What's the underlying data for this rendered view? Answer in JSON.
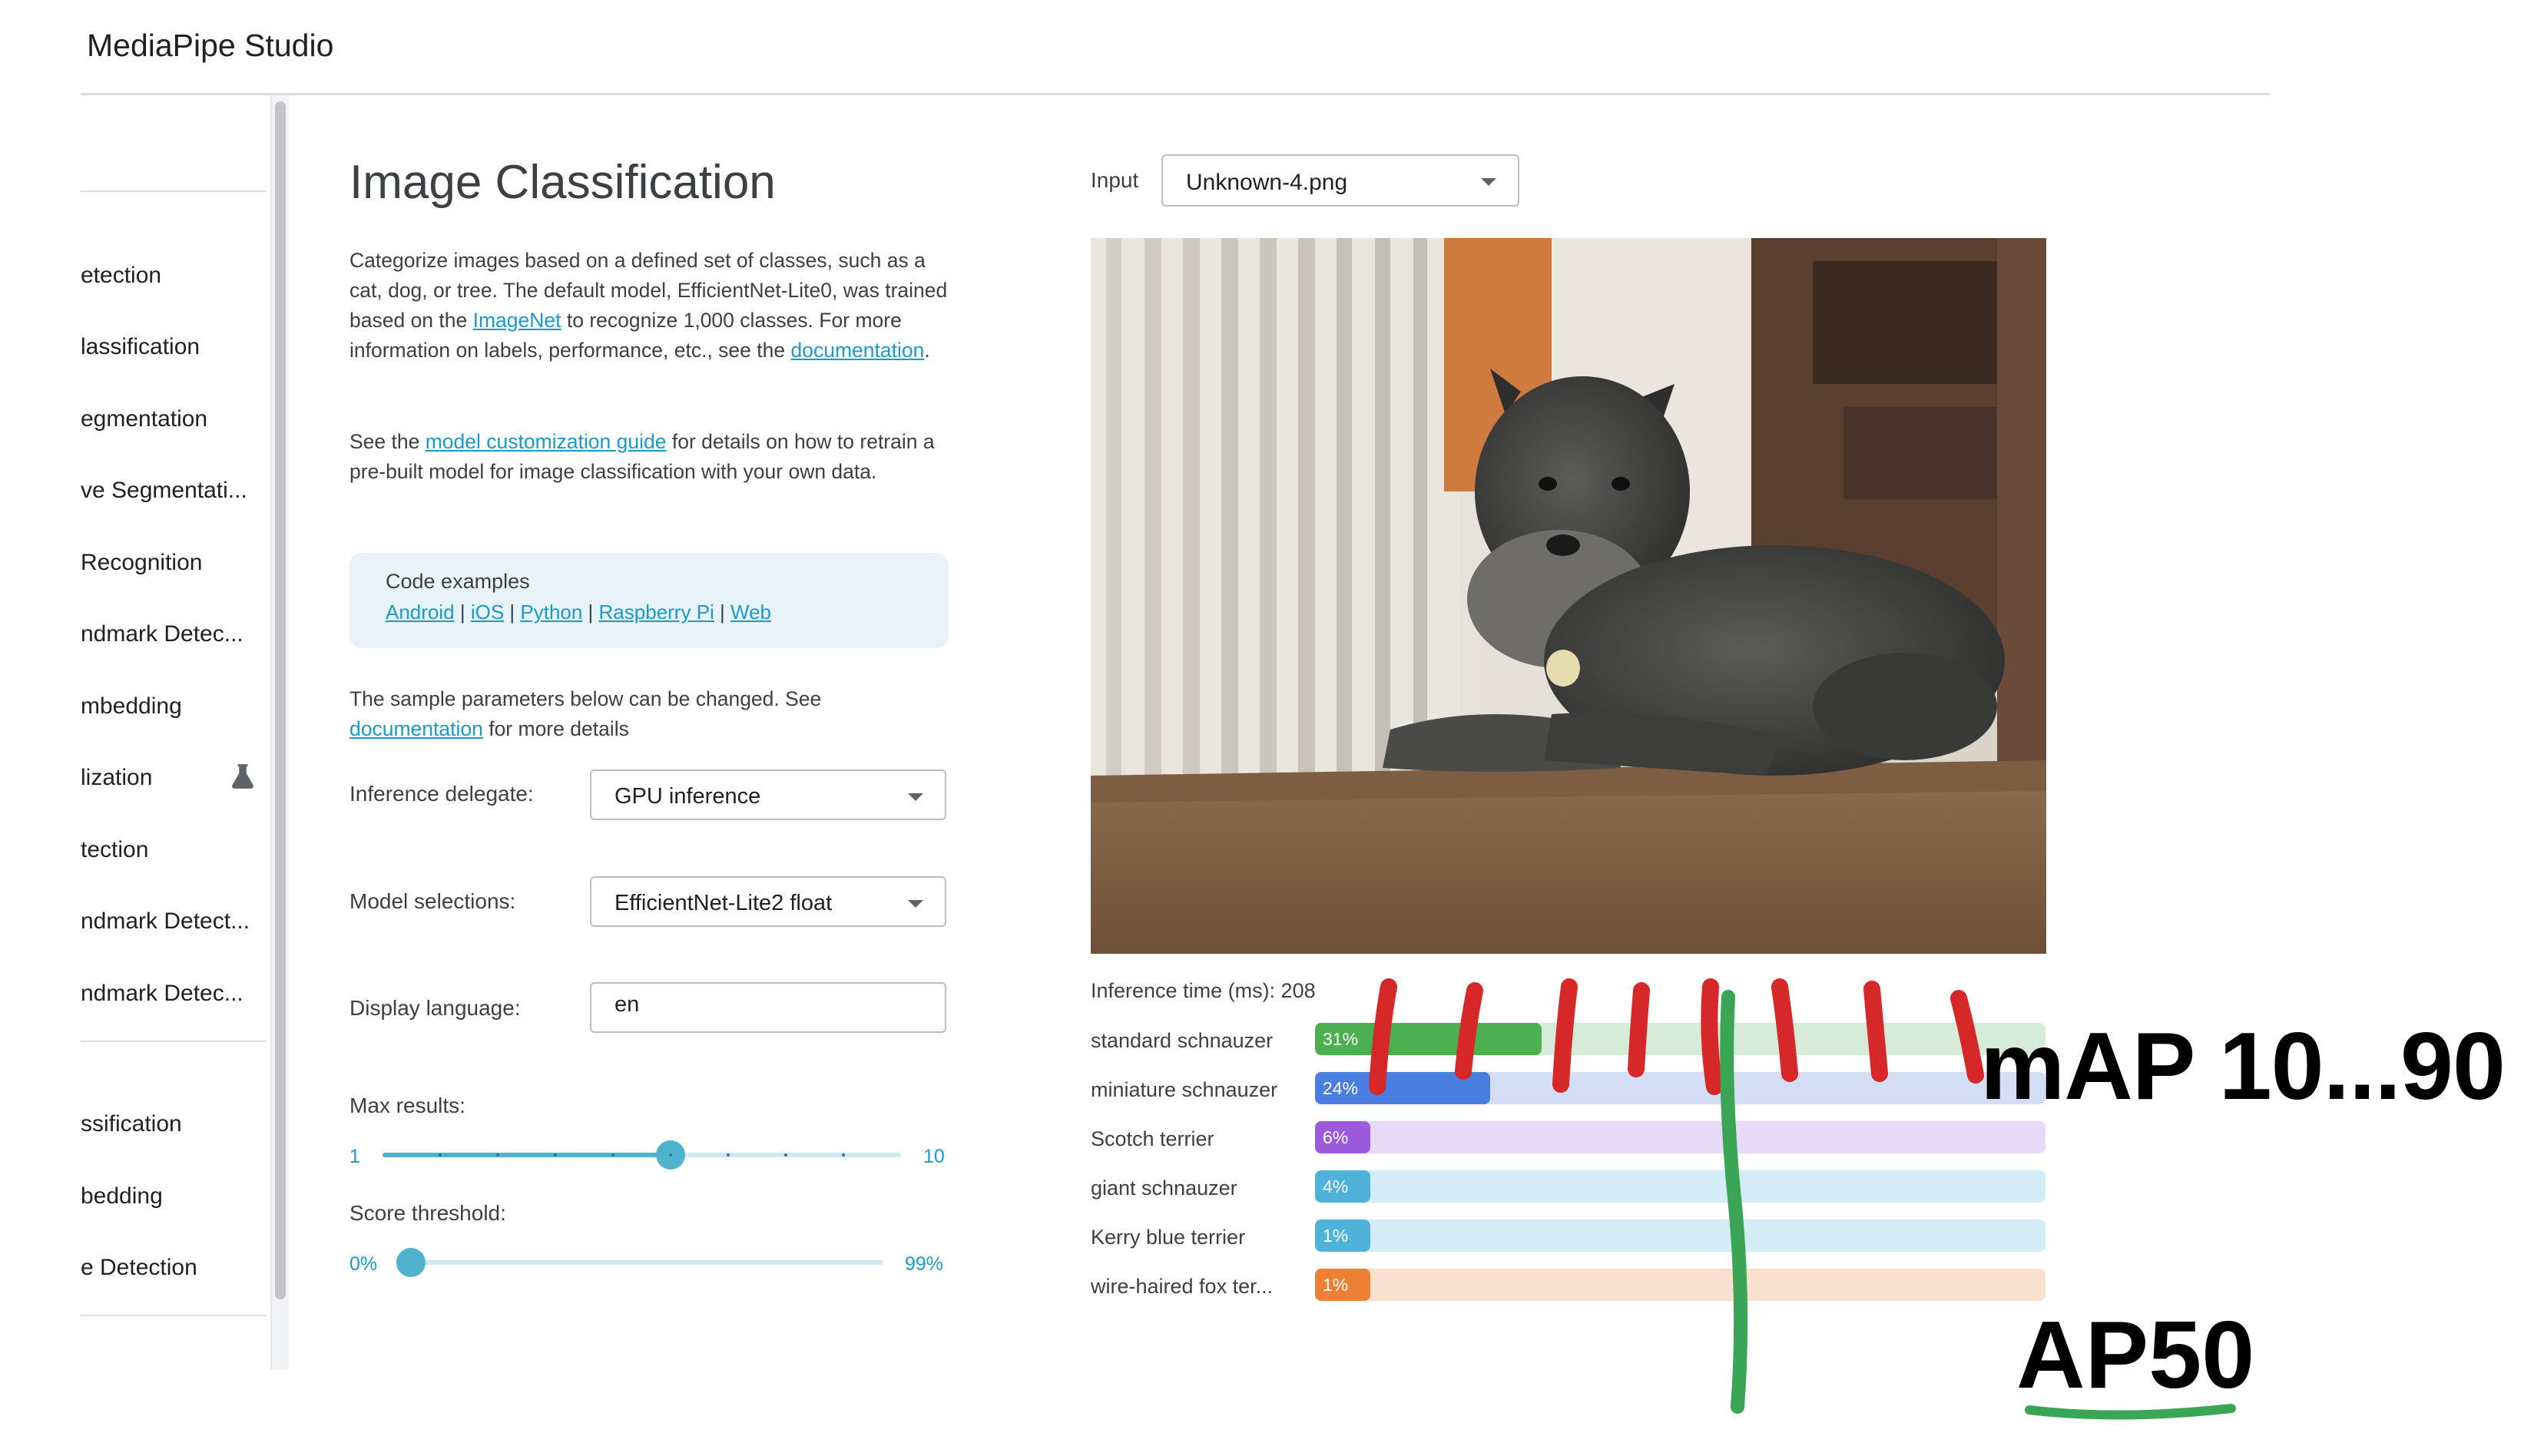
{
  "app": {
    "title": "MediaPipe Studio"
  },
  "sidebar": {
    "items": [
      {
        "label": "etection"
      },
      {
        "label": "lassification"
      },
      {
        "label": "egmentation"
      },
      {
        "label": "ve Segmentati..."
      },
      {
        "label": "Recognition"
      },
      {
        "label": "ndmark Detec..."
      },
      {
        "label": "mbedding"
      },
      {
        "label": "lization"
      },
      {
        "label": "tection"
      },
      {
        "label": "ndmark Detect..."
      },
      {
        "label": "ndmark Detec..."
      },
      {
        "label": "ssification"
      },
      {
        "label": "bedding"
      },
      {
        "label": "e Detection"
      }
    ],
    "flask_icon": "flask-icon"
  },
  "main": {
    "title": "Image Classification",
    "desc1": {
      "pre": "Categorize images based on a defined set of classes, such as a cat, dog, or tree. The default model, EfficientNet-Lite0, was trained based on the ",
      "link1": "ImageNet",
      "mid": " to recognize 1,000 classes. For more information on labels, performance, etc., see the ",
      "link2": "documentation",
      "post": "."
    },
    "desc2": {
      "pre": "See the ",
      "link": "model customization guide",
      "post": " for details on how to retrain a pre-built model for image classification with your own data."
    },
    "code": {
      "title": "Code examples",
      "links": [
        "Android",
        "iOS",
        "Python",
        "Raspberry Pi",
        "Web"
      ],
      "sep": " | "
    },
    "params": {
      "pre": "The sample parameters below can be changed. See ",
      "link": "documentation",
      "post": " for more details"
    },
    "form": {
      "delegate_label": "Inference delegate:",
      "delegate_value": "GPU inference",
      "model_label": "Model selections:",
      "model_value": "EfficientNet-Lite2 float",
      "lang_label": "Display language:",
      "lang_value": "en",
      "max_label": "Max results:",
      "max_min": "1",
      "max_max": "10",
      "max_value": 6,
      "score_label": "Score threshold:",
      "score_min": "0%",
      "score_max": "99%",
      "score_value": 0
    }
  },
  "right": {
    "input_label": "Input",
    "input_value": "Unknown-4.png",
    "inference_label": "Inference time (ms): 208",
    "results": [
      {
        "label": "standard schnauzer",
        "pct": "31%",
        "value": 0.31,
        "fill": "#4caf50",
        "track": "#d6ecd8"
      },
      {
        "label": "miniature schnauzer",
        "pct": "24%",
        "value": 0.24,
        "fill": "#4a7de0",
        "track": "#d3ddf6"
      },
      {
        "label": "Scotch terrier",
        "pct": "6%",
        "value": 0.06,
        "fill": "#9c5bdc",
        "track": "#e7d9f7"
      },
      {
        "label": "giant schnauzer",
        "pct": "4%",
        "value": 0.04,
        "fill": "#4fb3d9",
        "track": "#d3ecf5"
      },
      {
        "label": "Kerry blue terrier",
        "pct": "1%",
        "value": 0.01,
        "fill": "#4fb3d9",
        "track": "#d3ecf5"
      },
      {
        "label": "wire-haired fox ter...",
        "pct": "1%",
        "value": 0.01,
        "fill": "#ee8035",
        "track": "#f9e0cf"
      }
    ]
  },
  "annotations": {
    "map_label": "mAP 10...90",
    "ap_label": "AP50",
    "red_color": "#d62828",
    "green_color": "#3aa655"
  }
}
